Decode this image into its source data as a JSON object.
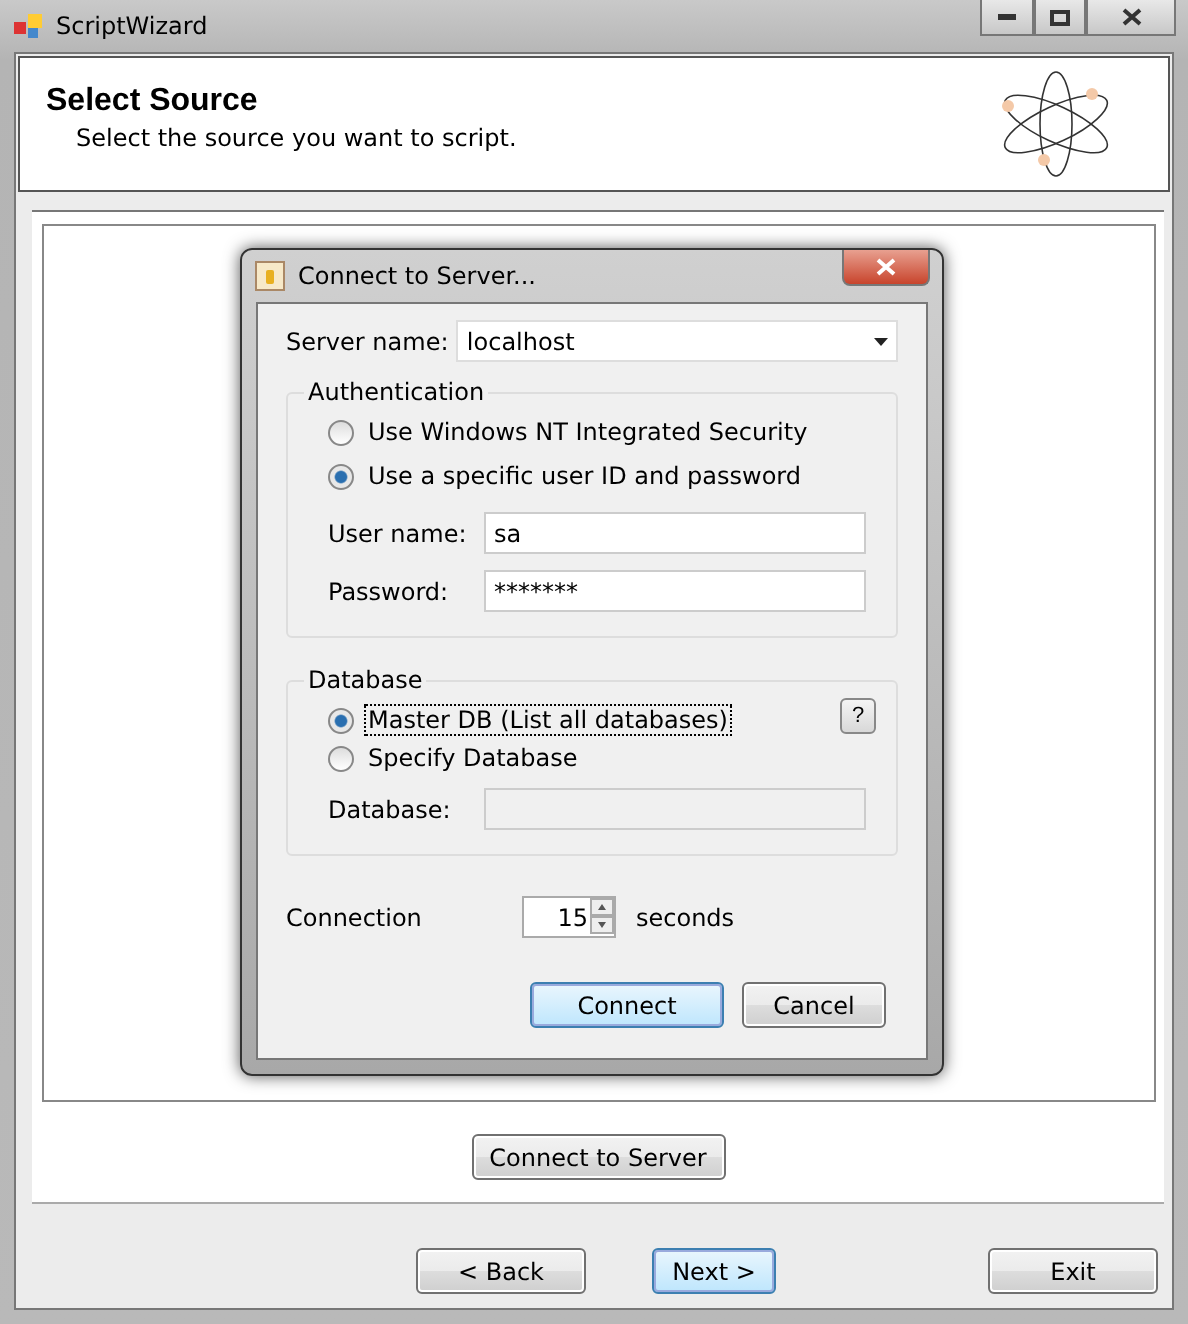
{
  "window": {
    "title": "ScriptWizard"
  },
  "header": {
    "title": "Select Source",
    "subtitle": "Select the source you want to script."
  },
  "connect_button": "Connect to Server",
  "nav_buttons": [
    {
      "label": "< Back",
      "default": false
    },
    {
      "label": "Next >",
      "default": true
    },
    {
      "label": "Exit",
      "default": false
    }
  ],
  "dialog": {
    "title": "Connect to Server...",
    "server_label": "Server name:",
    "server_value": "localhost",
    "authentication": {
      "legend": "Authentication",
      "options": [
        {
          "label": "Use Windows NT Integrated Security",
          "selected": false
        },
        {
          "label": "Use a specific user ID and password",
          "selected": true
        }
      ],
      "user_label": "User name:",
      "user_value": "sa",
      "password_label": "Password:",
      "password_value": "*******"
    },
    "database": {
      "legend": "Database",
      "help": "?",
      "options": [
        {
          "label": "Master DB (List all databases)",
          "selected": true,
          "focused": true
        },
        {
          "label": "Specify Database",
          "selected": false,
          "focused": false
        }
      ],
      "db_label": "Database:"
    },
    "connection_label": "Connection",
    "timeout": "15",
    "timeout_unit": "seconds",
    "buttons": [
      {
        "label": "Connect",
        "default": true
      },
      {
        "label": "Cancel",
        "default": false
      }
    ]
  }
}
